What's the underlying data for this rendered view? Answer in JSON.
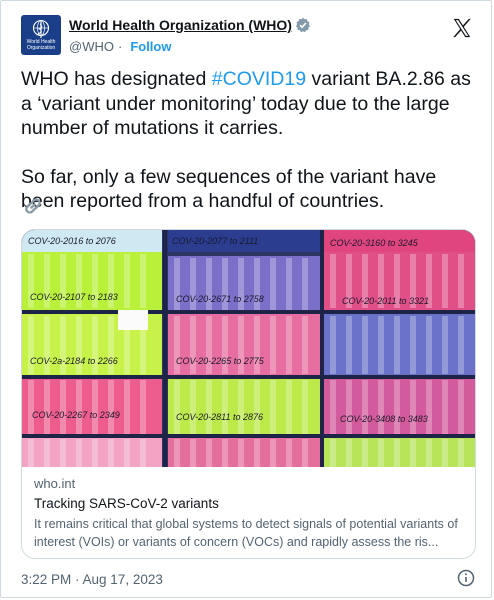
{
  "author": {
    "name": "World Health Organization (WHO)",
    "handle": "@WHO",
    "follow_label": "Follow",
    "avatar_text": "World Health Organization",
    "verified_icon": "verified-badge-icon"
  },
  "tweet": {
    "p1_before": "WHO has designated ",
    "hashtag": "#COVID19",
    "p1_after": " variant BA.2.86 as a ‘variant under monitoring’ today due to the large number of mutations it carries.",
    "p2": "So far, only a few sequences of the variant have been reported from a handful of countries."
  },
  "photo_labels": [
    "COV-20-2016 to 2076",
    "COV-20-2077 to 2111",
    "COV-20-3160 to 3245",
    "COV-20-2107 to 2183",
    "COV-20-2671 to 2758",
    "COV-20-2011 to 3321",
    "COV-2a-2184 to 2266",
    "COV-20-2265 to 2775",
    "COV-20-2267 to 2349",
    "COV-20-2811 to 2876",
    "COV-20-3408 to 3483"
  ],
  "link_card": {
    "domain": "who.int",
    "title": "Tracking SARS-CoV-2 variants",
    "description": "It remains critical that global systems to detect signals of potential variants of interest (VOIs) or variants of concern (VOCs) and rapidly assess the ris..."
  },
  "footer": {
    "timestamp": "3:22 PM · Aug 17, 2023"
  },
  "colors": {
    "link_blue": "#1d9bf0",
    "who_blue": "#1a3f88",
    "muted": "#536471"
  }
}
